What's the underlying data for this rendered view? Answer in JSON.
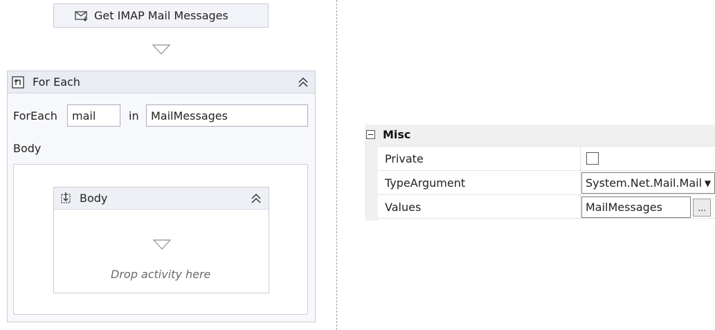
{
  "activities": {
    "get_imap": {
      "label": "Get IMAP Mail Messages",
      "icon": "mail-download-icon"
    },
    "for_each": {
      "title": "For Each",
      "icon": "foreach-icon",
      "foreach_label": "ForEach",
      "item_value": "mail",
      "in_label": "in",
      "collection_value": "MailMessages",
      "body_label": "Body",
      "body_sequence": {
        "title": "Body",
        "icon": "sequence-icon",
        "drop_hint": "Drop activity here"
      }
    }
  },
  "properties": {
    "category": "Misc",
    "rows": [
      {
        "name": "Private",
        "type": "checkbox",
        "checked": false
      },
      {
        "name": "TypeArgument",
        "type": "combo",
        "value": "System.Net.Mail.MailMessage"
      },
      {
        "name": "Values",
        "type": "text-ellipsis",
        "value": "MailMessages",
        "button": "..."
      }
    ]
  },
  "colors": {
    "activity_bg": "#f2f3f8",
    "border": "#c9cdd8",
    "header_bg": "#e9ecf3"
  }
}
